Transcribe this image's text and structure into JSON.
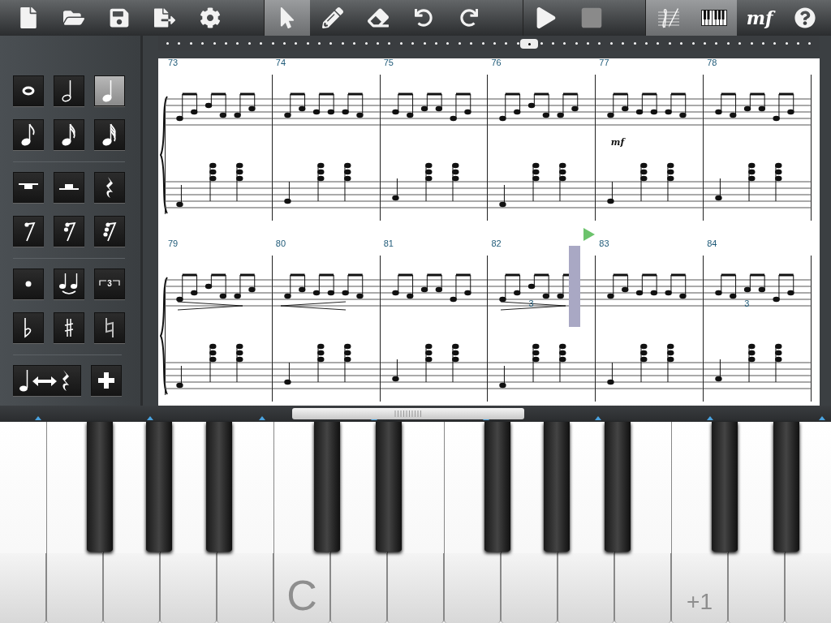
{
  "toolbar": {
    "groups": [
      [
        {
          "kind": "new",
          "selected": false
        },
        {
          "kind": "open",
          "selected": false
        },
        {
          "kind": "save",
          "selected": false
        },
        {
          "kind": "export",
          "selected": false
        },
        {
          "kind": "settings",
          "selected": false
        }
      ],
      [
        {
          "kind": "select",
          "selected": true
        },
        {
          "kind": "pencil",
          "selected": false
        },
        {
          "kind": "eraser",
          "selected": false
        },
        {
          "kind": "undo",
          "selected": false
        },
        {
          "kind": "redo",
          "selected": false
        }
      ],
      [
        {
          "kind": "play",
          "selected": false
        },
        {
          "kind": "stop",
          "selected": false
        }
      ],
      [
        {
          "kind": "notation",
          "selected": true
        },
        {
          "kind": "keyboard",
          "selected": true
        },
        {
          "kind": "dynamics",
          "label": "mf",
          "selected": false
        },
        {
          "kind": "help",
          "selected": false
        }
      ]
    ]
  },
  "palette": {
    "groups": [
      [
        [
          {
            "kind": "whole",
            "selected": false
          },
          {
            "kind": "half",
            "selected": false
          },
          {
            "kind": "quarter",
            "selected": true
          }
        ],
        [
          {
            "kind": "eighth",
            "selected": false
          },
          {
            "kind": "sixteenth",
            "selected": false
          },
          {
            "kind": "thirtysecond",
            "selected": false
          }
        ]
      ],
      [
        [
          {
            "kind": "whole-rest",
            "selected": false
          },
          {
            "kind": "half-rest",
            "selected": false
          },
          {
            "kind": "quarter-rest",
            "selected": false
          }
        ],
        [
          {
            "kind": "eighth-rest",
            "selected": false
          },
          {
            "kind": "sixteenth-rest",
            "selected": false
          },
          {
            "kind": "thirtysecond-rest",
            "selected": false
          }
        ]
      ],
      [
        [
          {
            "kind": "dot",
            "selected": false
          },
          {
            "kind": "tie",
            "selected": false
          },
          {
            "kind": "tuplet",
            "label": "3",
            "selected": false
          }
        ],
        [
          {
            "kind": "flat",
            "selected": false
          },
          {
            "kind": "sharp",
            "selected": false
          },
          {
            "kind": "natural",
            "selected": false
          }
        ]
      ],
      [
        [
          {
            "kind": "swap",
            "selected": false
          },
          {
            "kind": "add",
            "selected": false
          }
        ]
      ]
    ]
  },
  "score": {
    "systems": [
      {
        "measures": [
          {
            "number": "73",
            "cursor": false
          },
          {
            "number": "74",
            "cursor": false
          },
          {
            "number": "75",
            "cursor": false
          },
          {
            "number": "76",
            "cursor": false
          },
          {
            "number": "77",
            "dynamic": "mf",
            "cursor": false
          },
          {
            "number": "78",
            "cursor": false
          }
        ]
      },
      {
        "measures": [
          {
            "number": "79",
            "hairpin": {
              "kind": "decrescendo"
            },
            "cursor": false
          },
          {
            "number": "80",
            "hairpin": {
              "kind": "crescendo"
            },
            "cursor": false
          },
          {
            "number": "81",
            "cursor": false
          },
          {
            "number": "82",
            "hairpin": {
              "kind": "decrescendo"
            },
            "tuplet": "3",
            "cursor": true
          },
          {
            "number": "83",
            "cursor": false
          },
          {
            "number": "84",
            "tuplet": "3",
            "cursor": false
          }
        ]
      }
    ]
  },
  "keyboard": {
    "octave_labels": [
      "C",
      "+1"
    ]
  }
}
